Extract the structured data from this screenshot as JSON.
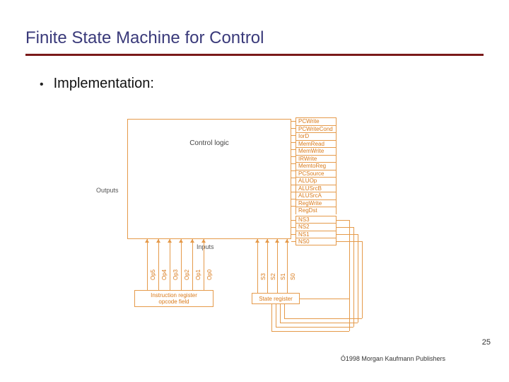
{
  "title": "Finite State Machine for Control",
  "bullet": "Implementation:",
  "diagram": {
    "logic_label": "Control logic",
    "outputs_label": "Outputs",
    "inputs_label": "Inputs",
    "signals": [
      "PCWrite",
      "PCWriteCond",
      "IorD",
      "MemRead",
      "MemWrite",
      "IRWrite",
      "MemtoReg",
      "PCSource",
      "ALUOp",
      "ALUSrcB",
      "ALUSrcA",
      "RegWrite",
      "RegDst"
    ],
    "ns_signals": [
      "NS3",
      "NS2",
      "NS1",
      "NS0"
    ],
    "op_inputs": [
      "Op5",
      "Op4",
      "Op3",
      "Op2",
      "Op1",
      "Op0"
    ],
    "state_inputs": [
      "S3",
      "S2",
      "S1",
      "S0"
    ],
    "instr_box_l1": "Instruction register",
    "instr_box_l2": "opcode field",
    "state_box": "State register"
  },
  "page_number": "25",
  "copyright": "Ó1998 Morgan Kaufmann Publishers"
}
